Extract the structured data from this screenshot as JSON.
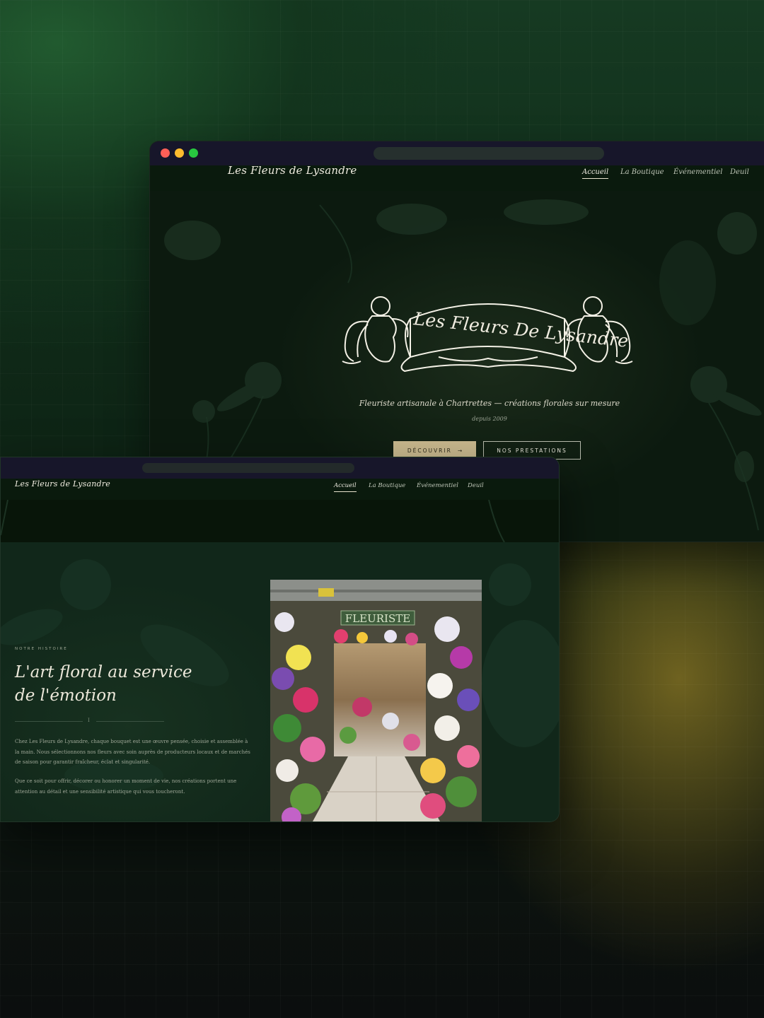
{
  "site": {
    "logo_text": "Les Fleurs de Lysandre",
    "hero_logo_text": "Les Fleurs De Lysandre",
    "nav": [
      "Accueil",
      "La Boutique",
      "Événementiel",
      "Deuil"
    ],
    "active_nav": "Accueil"
  },
  "hero": {
    "tagline": "Fleuriste artisanale à Chartrettes — créations florales sur mesure",
    "since": "depuis 2009",
    "primary_button": "DÉCOUVRIR",
    "primary_arrow": "→",
    "secondary_button": "NOS PRESTATIONS"
  },
  "story": {
    "eyebrow": "NOTRE HISTOIRE",
    "heading_line1": "L'art floral au service",
    "heading_line2": "de l'émotion",
    "divider_mark": "I",
    "paragraph1": [
      "Chez Les Fleurs de Lysandre, chaque bouquet est une œuvre pensée, choisie et assemblée à",
      "la main. Nous sélectionnons nos fleurs avec soin auprès de producteurs locaux et de marchés",
      "de saison pour garantir fraîcheur, éclat et singularité."
    ],
    "paragraph2": [
      "Que ce soit pour offrir, décorer ou honorer un moment de vie, nos créations portent une",
      "attention au détail et une sensibilité artistique qui vous toucheront."
    ],
    "shop_sign": "FLEURISTE"
  },
  "colors": {
    "chrome": "#17162a",
    "primary_button": "#c9b98e",
    "dot_red": "#fe5f57",
    "dot_yellow": "#febc2e",
    "dot_green": "#28c840"
  }
}
